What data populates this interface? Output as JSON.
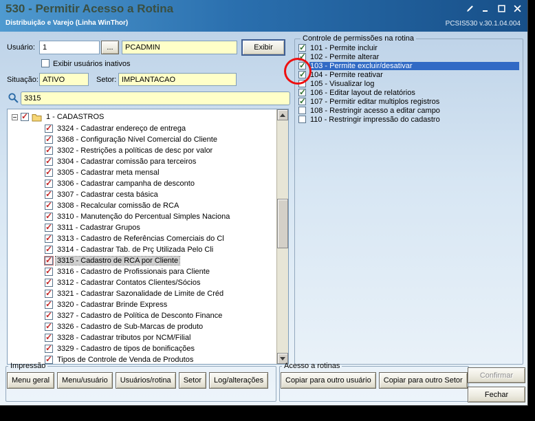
{
  "window": {
    "title": "530 - Permitir Acesso a Rotina",
    "subtitle": "Distribuição e Varejo (Linha WinThor)",
    "version": "PCSIS530  v.30.1.04.004"
  },
  "icons": {
    "titlebar": [
      "pencil-icon",
      "minimize-icon",
      "maximize-icon",
      "close-icon"
    ],
    "search": "magnifier-icon",
    "tree_root": "folder-icon"
  },
  "colors": {
    "titlebar_blue_start": "#4f9ad0",
    "titlebar_blue_end": "#174f88",
    "field_yellow": "#ffffc8",
    "selection_blue": "#316ac5",
    "tree_check_red": "#c22727",
    "perm_check_green": "#2f6f2f",
    "annotation_red": "#ee1010"
  },
  "user_section": {
    "user_label": "Usuário:",
    "user_code": "1",
    "browse_button_label": "...",
    "user_name": "PCADMIN",
    "show_button_label": "Exibir",
    "show_inactive_label": "Exibir usuários inativos",
    "show_inactive_checked": false,
    "situacao_label": "Situação:",
    "situacao_value": "ATIVO",
    "setor_label": "Setor:",
    "setor_value": "IMPLANTACAO"
  },
  "search": {
    "value": "3315"
  },
  "tree": {
    "root": {
      "label": "1 - CADASTROS",
      "checked": true
    },
    "items": [
      {
        "label": "3324 - Cadastrar endereço de entrega",
        "checked": true
      },
      {
        "label": "3368 - Configuração Nível Comercial do Cliente",
        "checked": true
      },
      {
        "label": "3302 - Restrições a políticas de desc por valor",
        "checked": true
      },
      {
        "label": "3304 - Cadastrar comissão para terceiros",
        "checked": true
      },
      {
        "label": "3305 - Cadastrar meta mensal",
        "checked": true
      },
      {
        "label": "3306 - Cadastrar campanha de desconto",
        "checked": true
      },
      {
        "label": "3307 - Cadastrar cesta básica",
        "checked": true
      },
      {
        "label": "3308 - Recalcular comissão de RCA",
        "checked": true
      },
      {
        "label": "3310 - Manutenção do Percentual Simples Naciona",
        "checked": true
      },
      {
        "label": "3311 - Cadastrar Grupos",
        "checked": true
      },
      {
        "label": "3313 - Cadastro de Referências Comerciais do Cl",
        "checked": true
      },
      {
        "label": "3314 - Cadastrar Tab. de Prç Utilizada Pelo Cli",
        "checked": true
      },
      {
        "label": "3315 - Cadastro de RCA por Cliente",
        "checked": true,
        "selected": true
      },
      {
        "label": "3316 - Cadastro de Profissionais para Cliente",
        "checked": true
      },
      {
        "label": "3312 - Cadastrar Contatos Clientes/Sócios",
        "checked": true
      },
      {
        "label": "3321 - Cadastrar Sazonalidade de Limite de Créd",
        "checked": true
      },
      {
        "label": "3320 - Cadastrar Brinde Express",
        "checked": true
      },
      {
        "label": "3327 - Cadastro de Política de Desconto Finance",
        "checked": true
      },
      {
        "label": "3326 - Cadastro de Sub-Marcas de produto",
        "checked": true
      },
      {
        "label": "3328 - Cadastrar tributos por NCM/Filial",
        "checked": true
      },
      {
        "label": "3329 - Cadastro de tipos de bonificações",
        "checked": true
      },
      {
        "label": "Tipos de Controle de Venda de Produtos",
        "checked": true
      }
    ]
  },
  "permissions": {
    "title": "Controle de permissões na rotina",
    "items": [
      {
        "label": "101 - Permite incluir",
        "checked": true
      },
      {
        "label": "102 - Permite alterar",
        "checked": true
      },
      {
        "label": "103 - Permite excluir/desativar",
        "checked": true,
        "selected": true
      },
      {
        "label": "104 - Permite reativar",
        "checked": true
      },
      {
        "label": "105 - Visualizar log",
        "checked": false
      },
      {
        "label": "106 - Editar layout de relatórios",
        "checked": true
      },
      {
        "label": "107 - Permitir editar multiplos registros",
        "checked": true
      },
      {
        "label": "108 - Restringir acesso a editar campo",
        "checked": false
      },
      {
        "label": "110 - Restringir impressão do cadastro",
        "checked": false
      }
    ]
  },
  "annotation": {
    "shape": "circle",
    "color": "#ee1010",
    "target": "checkbox of permission 103"
  },
  "impressao": {
    "title": "Impressão",
    "buttons": [
      "Menu geral",
      "Menu/usuário",
      "Usuários/rotina",
      "Setor",
      "Log/alterações"
    ]
  },
  "acesso": {
    "title": "Acesso a rotinas",
    "buttons": [
      "Copiar para outro usuário",
      "Copiar para outro Setor"
    ]
  },
  "actions": {
    "confirm_label": "Confirmar",
    "confirm_disabled": true,
    "close_label": "Fechar"
  }
}
